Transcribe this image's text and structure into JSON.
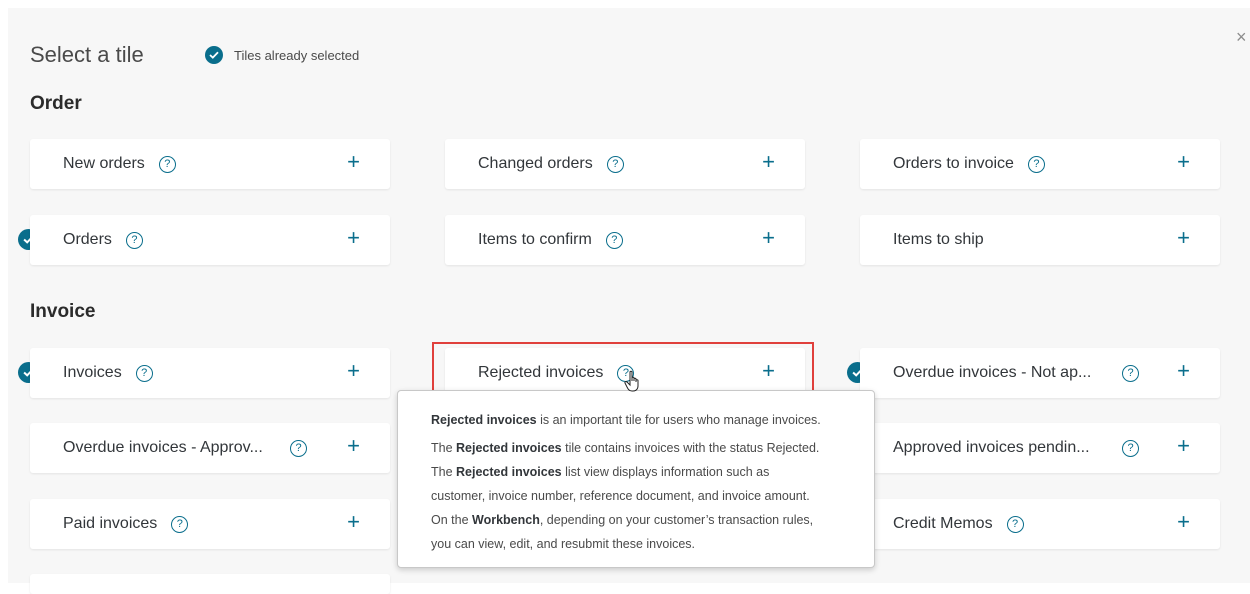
{
  "dialog": {
    "title": "Select a tile",
    "legend": "Tiles already selected",
    "close_icon": "close-icon",
    "accent_color": "#0a6e8c",
    "highlight_color": "#e0403c"
  },
  "sections": {
    "order": "Order",
    "invoice": "Invoice"
  },
  "tiles": {
    "new_orders": "New orders",
    "changed_orders": "Changed orders",
    "orders_to_invoice": "Orders to invoice",
    "orders": "Orders",
    "items_to_confirm": "Items to confirm",
    "items_to_ship": "Items to ship",
    "invoices": "Invoices",
    "rejected_invoices": "Rejected invoices",
    "overdue_not_approved": "Overdue invoices - Not ap...",
    "overdue_approved": "Overdue invoices - Approv...",
    "approved_pending": "Approved invoices pendin...",
    "paid_invoices": "Paid invoices",
    "credit_memos": "Credit Memos"
  },
  "glyphs": {
    "plus": "+",
    "help": "?",
    "close": "×"
  },
  "popover": {
    "line1_bold": "Rejected invoices",
    "line1_rest": " is an important tile for users who manage invoices.",
    "l2_a": "The ",
    "l2_bold": "Rejected invoices",
    "l2_b": " tile contains invoices with the status Rejected.",
    "l3_a": "The ",
    "l3_bold": "Rejected invoices",
    "l3_b": " list view displays information such as",
    "l4": "customer, invoice number, reference document, and invoice amount.",
    "l5_a": "On the ",
    "l5_bold": "Workbench",
    "l5_b": ", depending on your customer’s transaction rules,",
    "l6": "you can view, edit, and resubmit these invoices."
  }
}
